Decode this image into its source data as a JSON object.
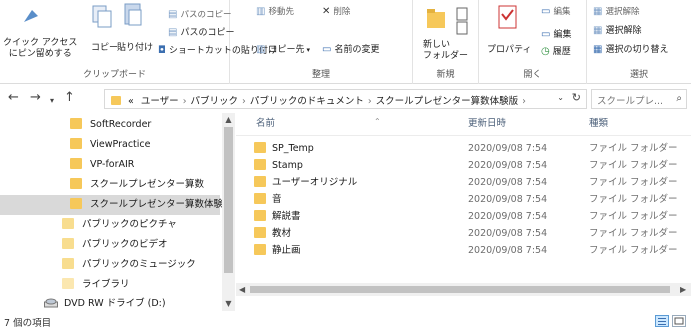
{
  "ribbon": {
    "clipboard": {
      "label": "クリップボード",
      "quick_access_line1": "クイック アクセス",
      "quick_access_line2": "にピン留めする",
      "copy": "コピー",
      "paste": "貼り付け",
      "copy_path": "パスのコピー",
      "paste_shortcut": "ショートカットの貼り付け",
      "cut_partial": "パスのコピー"
    },
    "organize": {
      "label": "整理",
      "move_to_partial": "移動先",
      "delete_partial": "削除",
      "copy_to": "コピー先",
      "rename": "名前の変更"
    },
    "new": {
      "label": "新規",
      "new_folder_line1": "新しい",
      "new_folder_line2": "フォルダー"
    },
    "open": {
      "label": "開く",
      "properties": "プロパティ",
      "edit": "編集",
      "history": "履歴",
      "open_partial": "編集"
    },
    "select": {
      "label": "選択",
      "select_all_partial": "選択解除",
      "select_none": "選択解除",
      "invert": "選択の切り替え"
    }
  },
  "address": {
    "overflow": "«",
    "segments": [
      "ユーザー",
      "パブリック",
      "パブリックのドキュメント",
      "スクールプレゼンター算数体験版"
    ],
    "search_placeholder": "スクールプレ..."
  },
  "nav_tree": [
    {
      "label": "SoftRecorder",
      "style": "normal"
    },
    {
      "label": "ViewPractice",
      "style": "normal"
    },
    {
      "label": "VP-forAIR",
      "style": "normal"
    },
    {
      "label": "スクールプレゼンター算数",
      "style": "normal"
    },
    {
      "label": "スクールプレゼンター算数体験版",
      "style": "selected"
    },
    {
      "label": "パブリックのピクチャ",
      "style": "normal"
    },
    {
      "label": "パブリックのビデオ",
      "style": "normal"
    },
    {
      "label": "パブリックのミュージック",
      "style": "normal"
    },
    {
      "label": "ライブラリ",
      "style": "normal"
    },
    {
      "label": "DVD RW ドライブ (D:)",
      "style": "drive"
    }
  ],
  "columns": {
    "name": "名前",
    "date": "更新日時",
    "kind": "種類"
  },
  "files": [
    {
      "name": "SP_Temp",
      "date": "2020/09/08 7:54",
      "kind": "ファイル フォルダー"
    },
    {
      "name": "Stamp",
      "date": "2020/09/08 7:54",
      "kind": "ファイル フォルダー"
    },
    {
      "name": "ユーザーオリジナル",
      "date": "2020/09/08 7:54",
      "kind": "ファイル フォルダー"
    },
    {
      "name": "音",
      "date": "2020/09/08 7:54",
      "kind": "ファイル フォルダー"
    },
    {
      "name": "解説書",
      "date": "2020/09/08 7:54",
      "kind": "ファイル フォルダー"
    },
    {
      "name": "教材",
      "date": "2020/09/08 7:54",
      "kind": "ファイル フォルダー"
    },
    {
      "name": "静止画",
      "date": "2020/09/08 7:54",
      "kind": "ファイル フォルダー"
    }
  ],
  "status": {
    "item_count": "7 個の項目"
  },
  "colors": {
    "folder": "#f6c85a",
    "selected_bg": "#d9d9d9",
    "accent": "#cce8ff"
  }
}
